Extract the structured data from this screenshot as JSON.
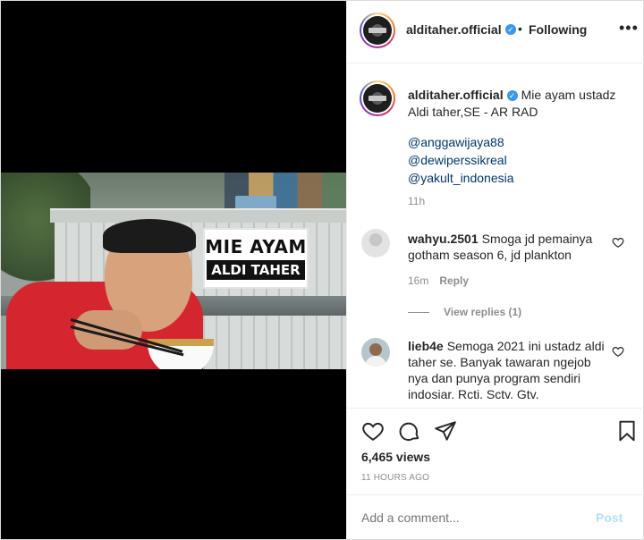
{
  "post": {
    "username": "alditaher.official",
    "verified_icon": "verified-badge-icon",
    "follow_separator": "•",
    "follow_status": "Following",
    "more_label": "•••"
  },
  "media": {
    "sign_line1": "MIE AYAM",
    "sign_line2": "ALDI TAHER"
  },
  "caption": {
    "username": "alditaher.official",
    "text": "Mie ayam ustadz Aldi taher,SE - AR RAD",
    "mentions": [
      "@anggawijaya88",
      "@dewiperssikreal",
      "@yakult_indonesia"
    ],
    "time": "11h"
  },
  "comments": [
    {
      "username": "wahyu.2501",
      "text": "Smoga jd pemainya gotham season 6, jd plankton",
      "time": "16m",
      "reply_label": "Reply",
      "view_replies": "View replies (1)"
    },
    {
      "username": "lieb4e",
      "text": "Semoga 2021 ini ustadz aldi taher se. Banyak tawaran ngejob nya dan punya program sendiri indosiar. Rcti. Sctv. Gtv."
    }
  ],
  "actions": {
    "like_icon": "heart-icon",
    "comment_icon": "comment-bubble-icon",
    "share_icon": "paper-plane-icon",
    "save_icon": "bookmark-icon"
  },
  "stats": {
    "views": "6,465 views",
    "time_ago": "11 HOURS AGO"
  },
  "composer": {
    "placeholder": "Add a comment...",
    "post_label": "Post"
  },
  "colors": {
    "link": "#00376b",
    "verified": "#3897f0",
    "muted": "#8e8e8e",
    "post_disabled": "#b2dffc"
  }
}
